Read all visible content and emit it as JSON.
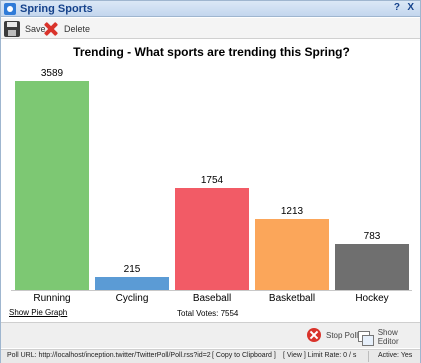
{
  "window": {
    "title": "Spring Sports",
    "help": "?",
    "close": "X"
  },
  "toolbar": {
    "save_label": "Save",
    "delete_label": "Delete"
  },
  "chart_data": {
    "type": "bar",
    "title": "Trending - What sports are trending this Spring?",
    "categories": [
      "Running",
      "Cycling",
      "Baseball",
      "Basketball",
      "Hockey"
    ],
    "values": [
      3589,
      215,
      1754,
      1213,
      783
    ],
    "colors": [
      "#7dc873",
      "#5b9bd5",
      "#f25b66",
      "#fba65a",
      "#6f6f6f"
    ],
    "ylim": [
      0,
      3589
    ],
    "grid": false,
    "legend": "none"
  },
  "links": {
    "pie_graph": "Show Pie Graph"
  },
  "totals": {
    "total_votes": "Total Votes: 7554"
  },
  "actions": {
    "stop_poll": "Stop Poll",
    "show_editor": "Show Editor"
  },
  "status": {
    "poll_url": "Poll URL: http://localhost/inception.twitter/TwitterPoll/Poll.rss?id=2",
    "copy": "[ Copy to Clipboard ]",
    "view": "[ View ] Limit Rate: 0 / s",
    "active": "Active: Yes"
  }
}
